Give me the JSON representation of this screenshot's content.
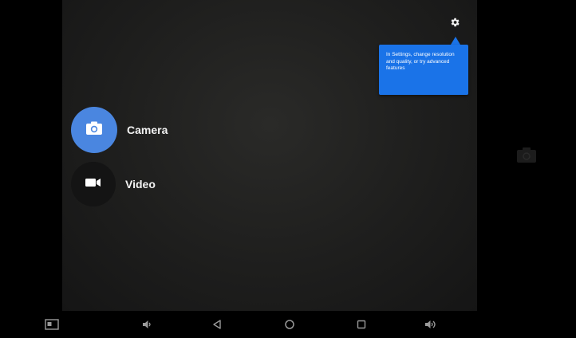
{
  "camera_app": {
    "tooltip_text": "In Settings, change resolution and quality, or try advanced features",
    "modes": [
      {
        "label": "Camera",
        "icon": "camera-icon",
        "active": true
      },
      {
        "label": "Video",
        "icon": "video-icon",
        "active": false
      }
    ],
    "settings_icon": "gear-icon",
    "switch_camera_icon": "switch-camera-icon",
    "accent_color": "#4a86e0",
    "tooltip_color": "#1a73e8"
  },
  "navbar": {
    "buttons": [
      {
        "icon": "screenshot-icon"
      },
      {
        "icon": "volume-down-icon"
      },
      {
        "icon": "back-icon"
      },
      {
        "icon": "home-icon"
      },
      {
        "icon": "recents-icon"
      },
      {
        "icon": "volume-up-icon"
      }
    ]
  }
}
